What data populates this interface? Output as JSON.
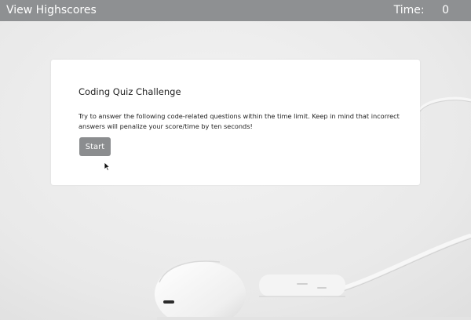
{
  "header": {
    "highscores_link": "View Highscores",
    "time_label": "Time:",
    "time_value": "0"
  },
  "quiz": {
    "title": "Coding Quiz Challenge",
    "description": "Try to answer the following code-related questions within the time limit. Keep in mind that incorrect answers will penalize your score/time by ten seconds!",
    "start_label": "Start"
  },
  "colors": {
    "topbar": "#8e9092",
    "button": "#8b8d8f",
    "card": "#ffffff",
    "background": "#ebebeb"
  },
  "icons": {
    "pointer": "mouse-pointer-icon"
  }
}
